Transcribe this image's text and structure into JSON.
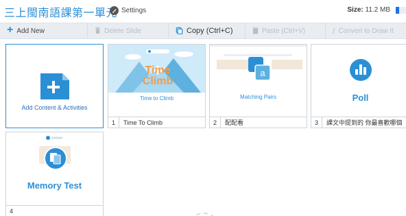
{
  "header": {
    "title": "三上閩南語課第一單元",
    "settings_label": "Settings",
    "size_label": "Size:",
    "size_value": "11.2 MB",
    "size_fill_fraction": 0.3
  },
  "toolbar": {
    "add_new": "Add New",
    "delete_slide": "Delete Slide",
    "copy": "Copy (Ctrl+C)",
    "paste": "Paste (Ctrl+V)",
    "convert": "Convert to Draw It"
  },
  "add_card": {
    "label": "Add Content & Activities"
  },
  "slides": [
    {
      "number": "1",
      "name": "Time To Climb",
      "caption": "Time to Climb"
    },
    {
      "number": "2",
      "name": "配配看",
      "caption": "Matching Pairs",
      "thumb_top_text": "遊戲規則"
    },
    {
      "number": "3",
      "name": "課文中提到的 你最喜歡哪個",
      "caption": "Poll"
    },
    {
      "number": "4",
      "name": "",
      "caption": "Memory Test",
      "thumb_top_text": "Memory Test"
    }
  ],
  "colors": {
    "accent": "#2b8fd6",
    "toolbar_bg": "#e9edf1"
  }
}
